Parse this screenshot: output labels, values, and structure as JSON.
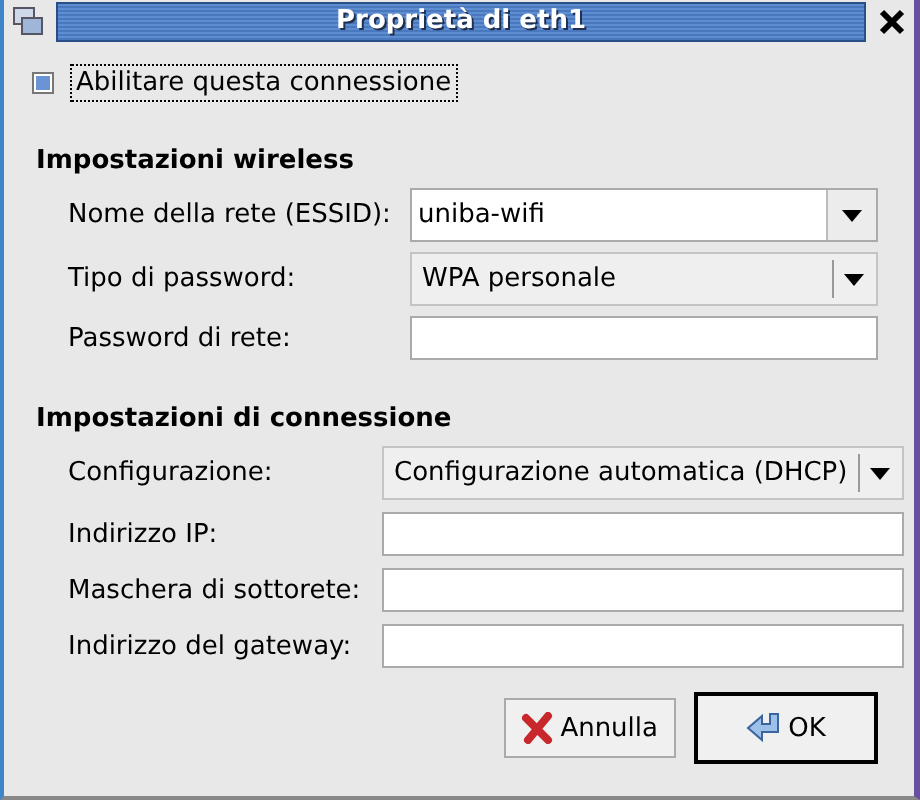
{
  "window": {
    "title": "Proprietà di eth1"
  },
  "enable": {
    "label": "Abilitare questa connessione",
    "checked": true
  },
  "sections": [
    {
      "title": "Impostazioni wireless",
      "rows": [
        {
          "kind": "combo-entry",
          "label": "Nome della rete (ESSID):",
          "value": "uniba-wifi"
        },
        {
          "kind": "combo",
          "label": "Tipo di password:",
          "value": "WPA personale"
        },
        {
          "kind": "entry",
          "label": "Password di rete:"
        }
      ]
    },
    {
      "title": "Impostazioni di connessione",
      "rows": [
        {
          "kind": "combo",
          "label": "Configurazione:",
          "value": "Configurazione automatica (DHCP)"
        },
        {
          "kind": "entry",
          "label": "Indirizzo IP:"
        },
        {
          "kind": "entry",
          "label": "Maschera di sottorete:"
        },
        {
          "kind": "entry",
          "label": "Indirizzo del gateway:"
        }
      ]
    }
  ],
  "buttons": [
    {
      "kind": "cancel",
      "label": "Annulla",
      "default": false
    },
    {
      "kind": "ok",
      "label": "OK",
      "default": true
    }
  ]
}
